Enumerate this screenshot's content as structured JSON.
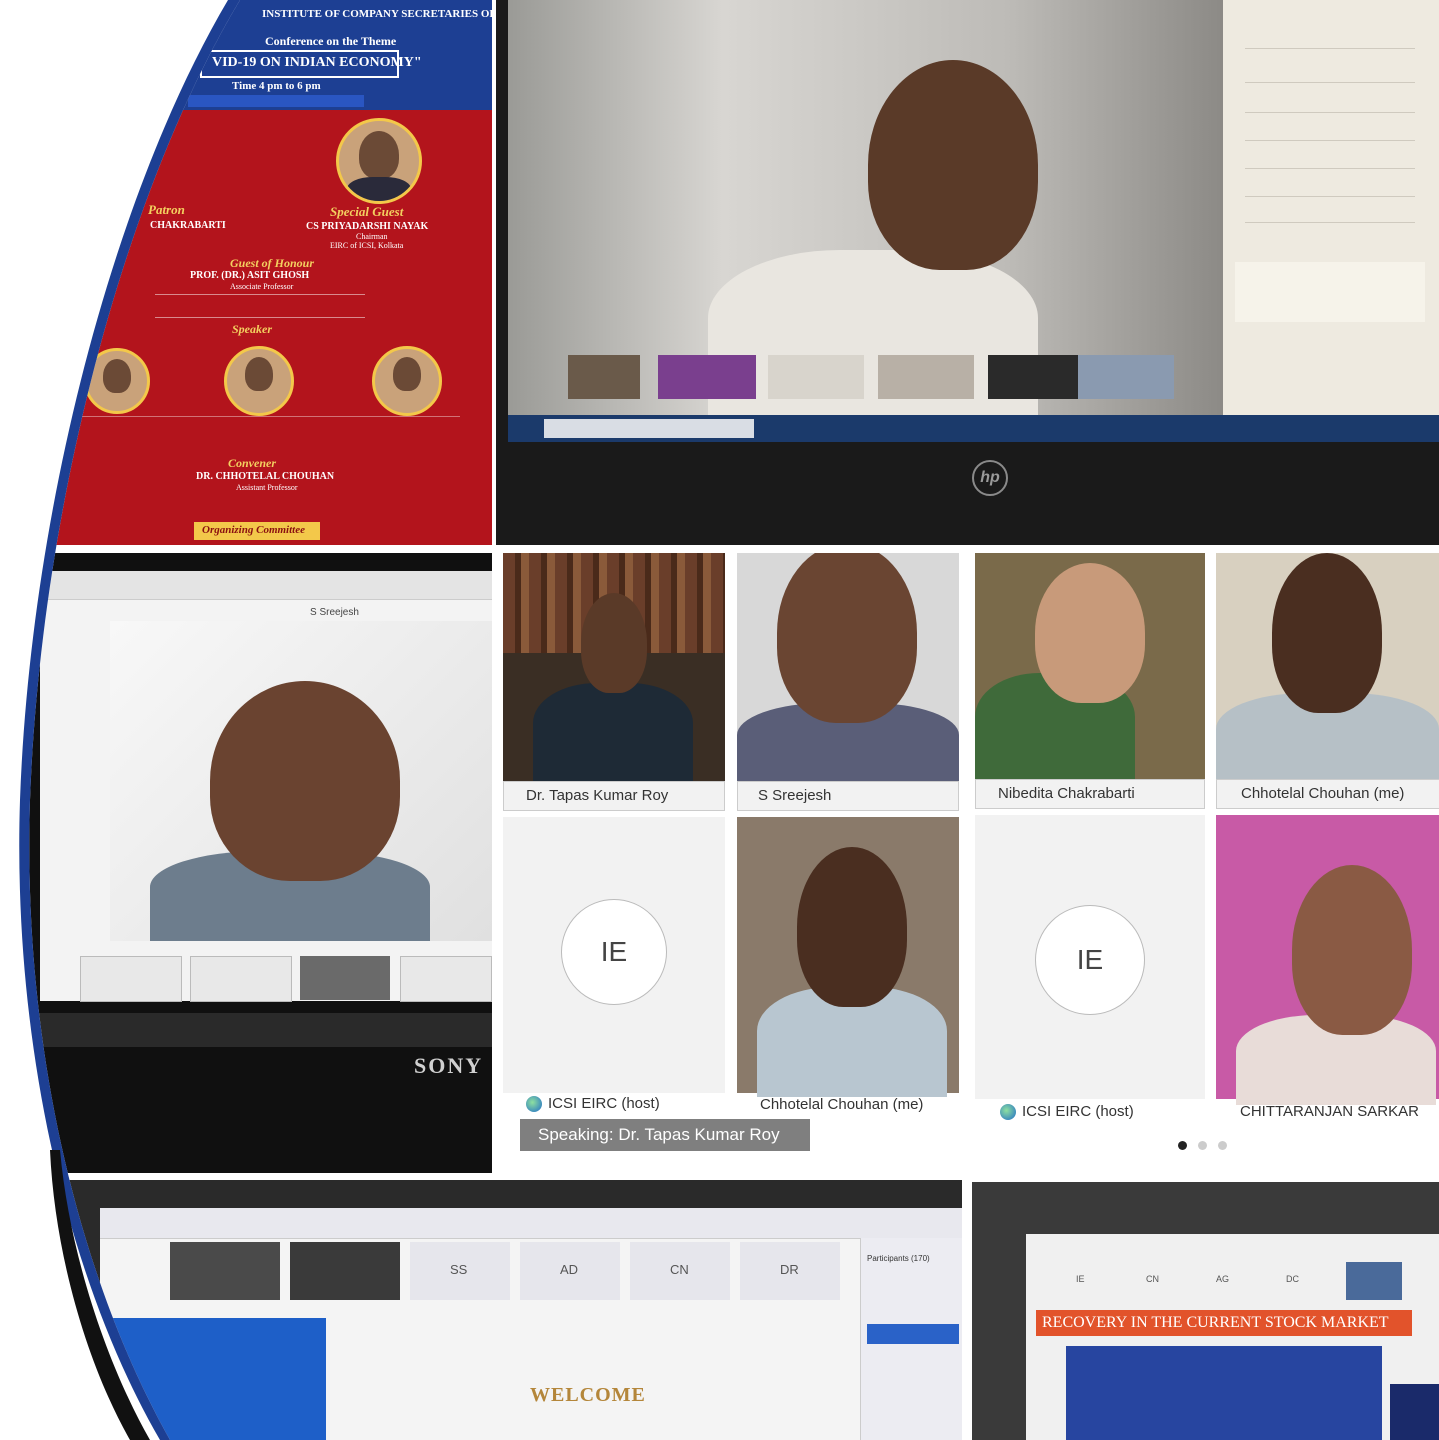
{
  "poster": {
    "org_line": "INSTITUTE OF COMPANY SECRETARIES OF INDIA",
    "conference_line": "Conference on the Theme",
    "theme": "VID-19 ON INDIAN ECONOMY\"",
    "time_line": "Time 4 pm to 6 pm",
    "patron_heading": "Patron",
    "patron_name": "CHAKRABARTI",
    "special_guest_heading": "Special Guest",
    "special_guest_name": "CS PRIYADARSHI NAYAK",
    "special_guest_role": "Chairman",
    "special_guest_org": "EIRC of ICSI, Kolkata",
    "guest_of_honour_heading": "Guest of Honour",
    "guest_of_honour_name": "PROF. (DR.) ASIT GHOSH",
    "guest_of_honour_role": "Associate Professor",
    "speaker_heading": "Speaker",
    "convener_heading": "Convener",
    "convener_name": "DR. CHHOTELAL CHOUHAN",
    "convener_role": "Assistant Professor",
    "organizing_committee": "Organizing Committee"
  },
  "laptop_tile": {
    "brand": "hp"
  },
  "participants_grid_left": {
    "tiles": [
      {
        "name": "Dr. Tapas  Kumar Roy"
      },
      {
        "name": "S Sreejesh"
      },
      {
        "name": "ICSI EIRC (host)",
        "initials": "IE"
      },
      {
        "name": "Chhotelal Chouhan (me)"
      }
    ],
    "speaking": "Speaking: Dr. Tapas  Kumar Roy"
  },
  "participants_grid_right": {
    "tiles": [
      {
        "name": "Nibedita Chakrabarti"
      },
      {
        "name": "Chhotelal Chouhan (me)"
      },
      {
        "name": "ICSI EIRC (host)",
        "initials": "IE"
      },
      {
        "name": "CHITTARANJAN SARKAR"
      }
    ],
    "pager_dots": 3
  },
  "sony_tile": {
    "brand": "SONY",
    "window_label": "S Sreejesh"
  },
  "bottom_left_tile": {
    "thumb_initials": [
      "SS",
      "AD",
      "CN",
      "DR"
    ],
    "participants_header": "Participants (170)",
    "slide_title": "WELCOME"
  },
  "bottom_right_tile": {
    "thumb_initials": [
      "IE",
      "CN",
      "AG",
      "DC"
    ],
    "slide_title": "RECOVERY IN THE CURRENT STOCK MARKET"
  },
  "colors": {
    "poster_red": "#b3141c",
    "poster_blue": "#1d3f93",
    "accent_gold": "#f3c84a",
    "name_bar_grey": "#f2f2f2",
    "speaking_bar": "#7f7f7f",
    "slide_orange": "#e2532b",
    "slide_blue": "#2745a0"
  }
}
